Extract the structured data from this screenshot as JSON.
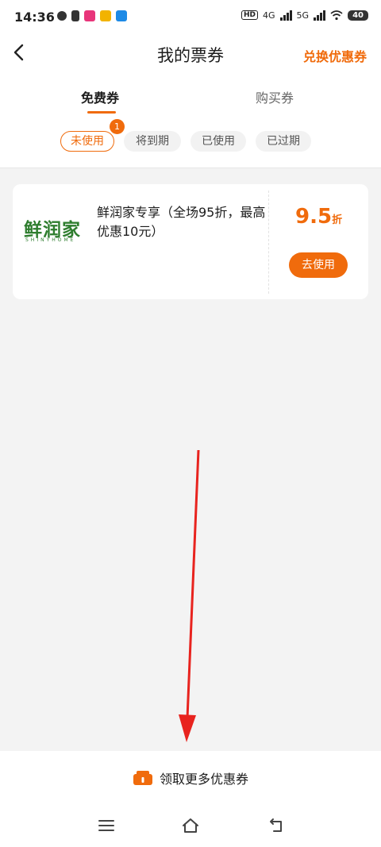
{
  "status_bar": {
    "time": "14:36",
    "network_labels": [
      "HD",
      "4G",
      "5G"
    ],
    "battery": "40"
  },
  "header": {
    "title": "我的票券",
    "redeem_label": "兑换优惠券"
  },
  "tabs": [
    {
      "label": "免费券",
      "active": true
    },
    {
      "label": "购买券",
      "active": false
    }
  ],
  "filters": [
    {
      "label": "未使用",
      "active": true,
      "badge": "1"
    },
    {
      "label": "将到期",
      "active": false
    },
    {
      "label": "已使用",
      "active": false
    },
    {
      "label": "已过期",
      "active": false
    }
  ],
  "coupon": {
    "logo_text": "鲜润家",
    "logo_sub": "SHINYHOME",
    "description": "鲜润家专享（全场95折，最高优惠10元）",
    "discount_value": "9.5",
    "discount_unit": "折",
    "use_label": "去使用"
  },
  "footer": {
    "get_more_label": "领取更多优惠券"
  },
  "colors": {
    "accent": "#f06b0c",
    "background": "#f3f3f3",
    "annotation_arrow": "#e8231e"
  },
  "icons": [
    "back-chevron-icon",
    "coupon-ticket-icon",
    "menu-icon",
    "home-icon",
    "return-icon"
  ]
}
